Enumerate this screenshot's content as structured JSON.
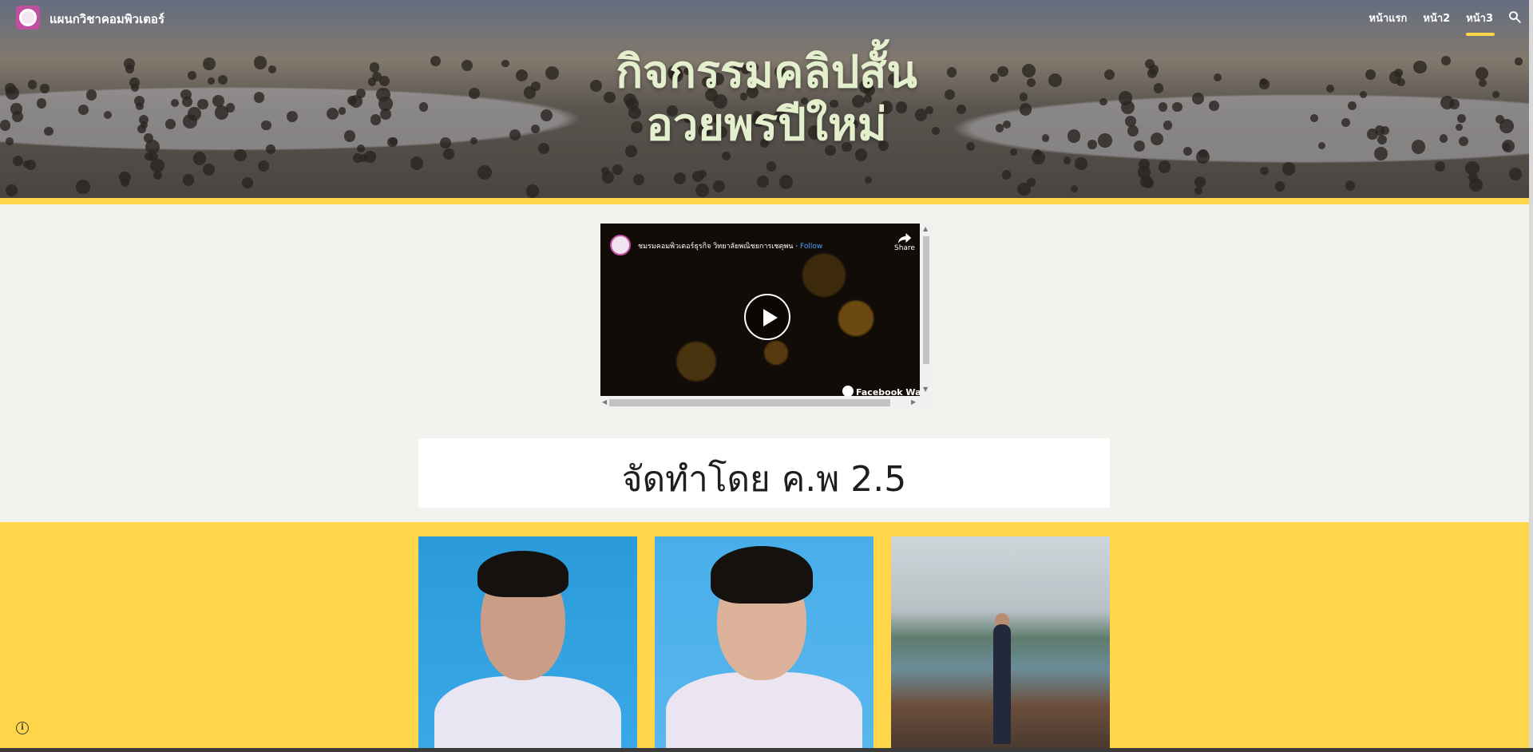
{
  "header": {
    "site_title": "แผนกวิชาคอมพิวเตอร์",
    "nav": [
      {
        "label": "หน้าแรก",
        "active": false
      },
      {
        "label": "หน้า2",
        "active": false
      },
      {
        "label": "หน้า3",
        "active": true
      }
    ],
    "search_icon": "search-icon"
  },
  "hero": {
    "title_line1": "กิจกรรมคลิปสั้น",
    "title_line2": "อวยพรปีใหม่"
  },
  "video": {
    "page_name": "ชมรมคอมพิวเตอร์ธุรกิจ วิทยาลัยพณิชยการเชตุพน",
    "separator": " · ",
    "follow_label": "Follow",
    "share_label": "Share",
    "watch_label": "Facebook Watch"
  },
  "credit": {
    "text": "จัดทำโดย ค.พ 2.5"
  },
  "colors": {
    "accent_yellow": "#ffd54a",
    "page_bg": "#f4f2ef",
    "hero_text": "#e3efcd"
  }
}
